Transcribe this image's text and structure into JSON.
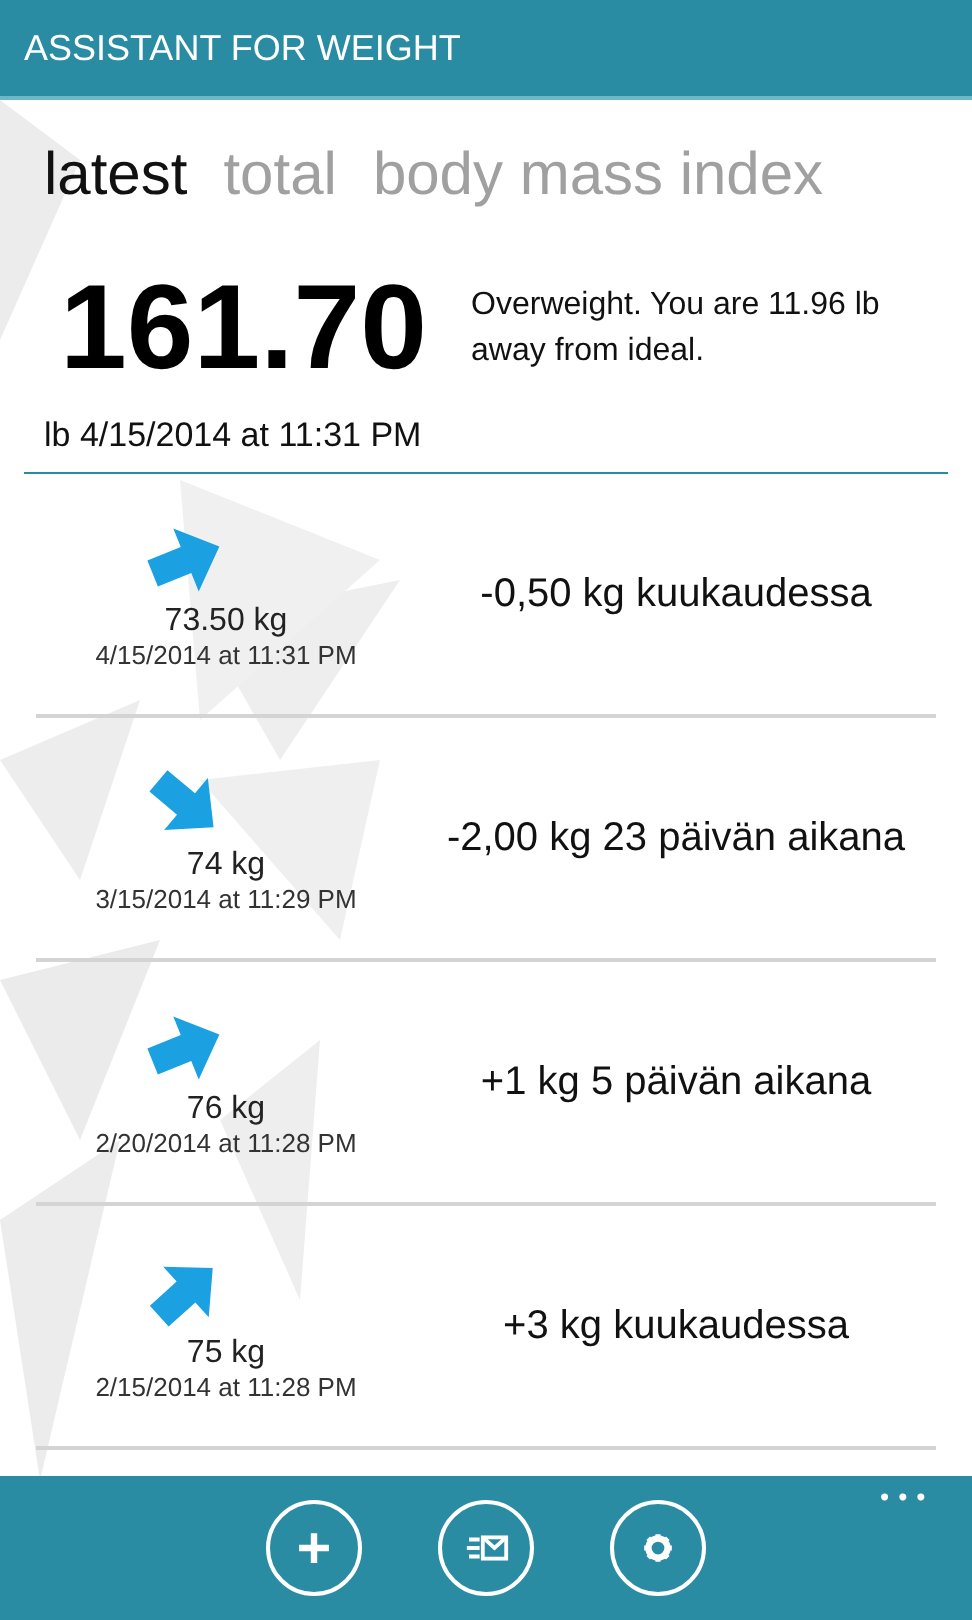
{
  "window": {
    "title": "ASSISTANT FOR WEIGHT"
  },
  "tabs": [
    {
      "label": "latest",
      "selected": true
    },
    {
      "label": "total",
      "selected": false
    },
    {
      "label": "body mass index",
      "selected": false
    }
  ],
  "summary": {
    "value": "161.70",
    "unit_date": "lb 4/15/2014 at 11:31 PM",
    "message": "Overweight. You are 11.96 lb away from ideal."
  },
  "entries": [
    {
      "kind": "slight",
      "weight": "73.50 kg",
      "date": "4/15/2014 at 11:31 PM",
      "change": "-0,50 kg kuukaudessa"
    },
    {
      "kind": "down",
      "weight": "74 kg",
      "date": "3/15/2014 at 11:29 PM",
      "change": "-2,00 kg 23 päivän aikana"
    },
    {
      "kind": "slight",
      "weight": "76 kg",
      "date": "2/20/2014 at 11:28 PM",
      "change": "+1 kg 5 päivän aikana"
    },
    {
      "kind": "up",
      "weight": "75 kg",
      "date": "2/15/2014 at 11:28 PM",
      "change": "+3 kg kuukaudessa"
    }
  ],
  "app_bar": {
    "buttons": [
      {
        "kind": "add"
      },
      {
        "kind": "mail"
      },
      {
        "kind": "settings"
      }
    ],
    "more": "•••"
  }
}
